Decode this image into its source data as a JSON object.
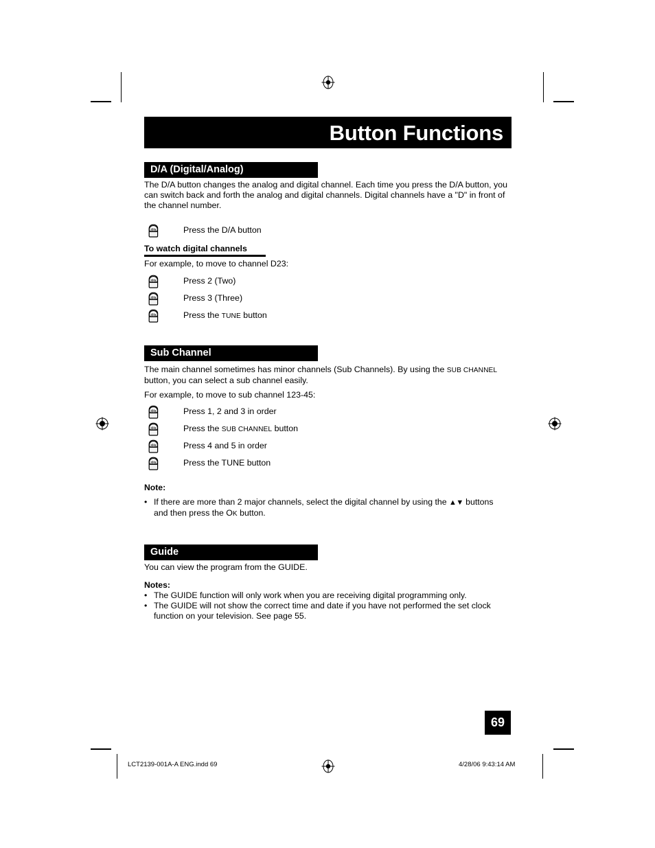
{
  "page": {
    "title": "Button Functions",
    "number": "69"
  },
  "sections": {
    "da": {
      "header": "D/A (Digital/Analog)",
      "body": "The D/A button changes the analog and digital channel.  Each time you press the D/A button, you can switch back and forth the analog and digital channels.  Digital channels have a \"D\" in front of the channel number.",
      "step_da": "Press the D/A button",
      "subhead": "To watch digital channels",
      "example": "For example, to move to channel D23:",
      "steps": [
        "Press 2 (Two)",
        "Press 3 (Three)"
      ],
      "step_tune_prefix": "Press the ",
      "step_tune_smallcaps": "TUNE",
      "step_tune_suffix": " button"
    },
    "sub_channel": {
      "header": "Sub Channel",
      "body_part1": "The main channel sometimes has minor channels (Sub Channels).  By using the ",
      "body_smallcaps": "SUB CHANNEL",
      "body_part2": " button, you can select a sub channel easily.",
      "example": "For example, to move to sub channel 123-45:",
      "step1": "Press 1, 2 and 3 in order",
      "step2_prefix": "Press the ",
      "step2_smallcaps": "SUB CHANNEL",
      "step2_suffix": " button",
      "step3": "Press 4 and 5 in order",
      "step4": "Press the TUNE button",
      "note_title": "Note:",
      "note_bullet": "•",
      "note_part1": "If there are more than 2 major channels, select the digital channel by using the ",
      "note_arrows": "▲▼",
      "note_part2": " buttons and then press the O",
      "note_ok_smallcaps": "K",
      "note_part3": " button."
    },
    "guide": {
      "header": "Guide",
      "body": "You can view the program from the GUIDE.",
      "notes_title": "Notes:",
      "bullet": "•",
      "notes": [
        "The GUIDE function will only work when you are receiving digital programming only.",
        "The GUIDE will not show the correct time and date if you have not performed the set clock function on your television.  See page 55."
      ]
    }
  },
  "footer": {
    "file_slug": "LCT2139-001A-A ENG.indd   69",
    "timestamp": "4/28/06   9:43:14 AM"
  },
  "colors": {
    "ink": "#000000",
    "paper": "#ffffff",
    "reverse_text": "#ffffff"
  },
  "icons": {
    "press_hand": "pressing-hand-icon",
    "registration": "registration-target-icon"
  }
}
